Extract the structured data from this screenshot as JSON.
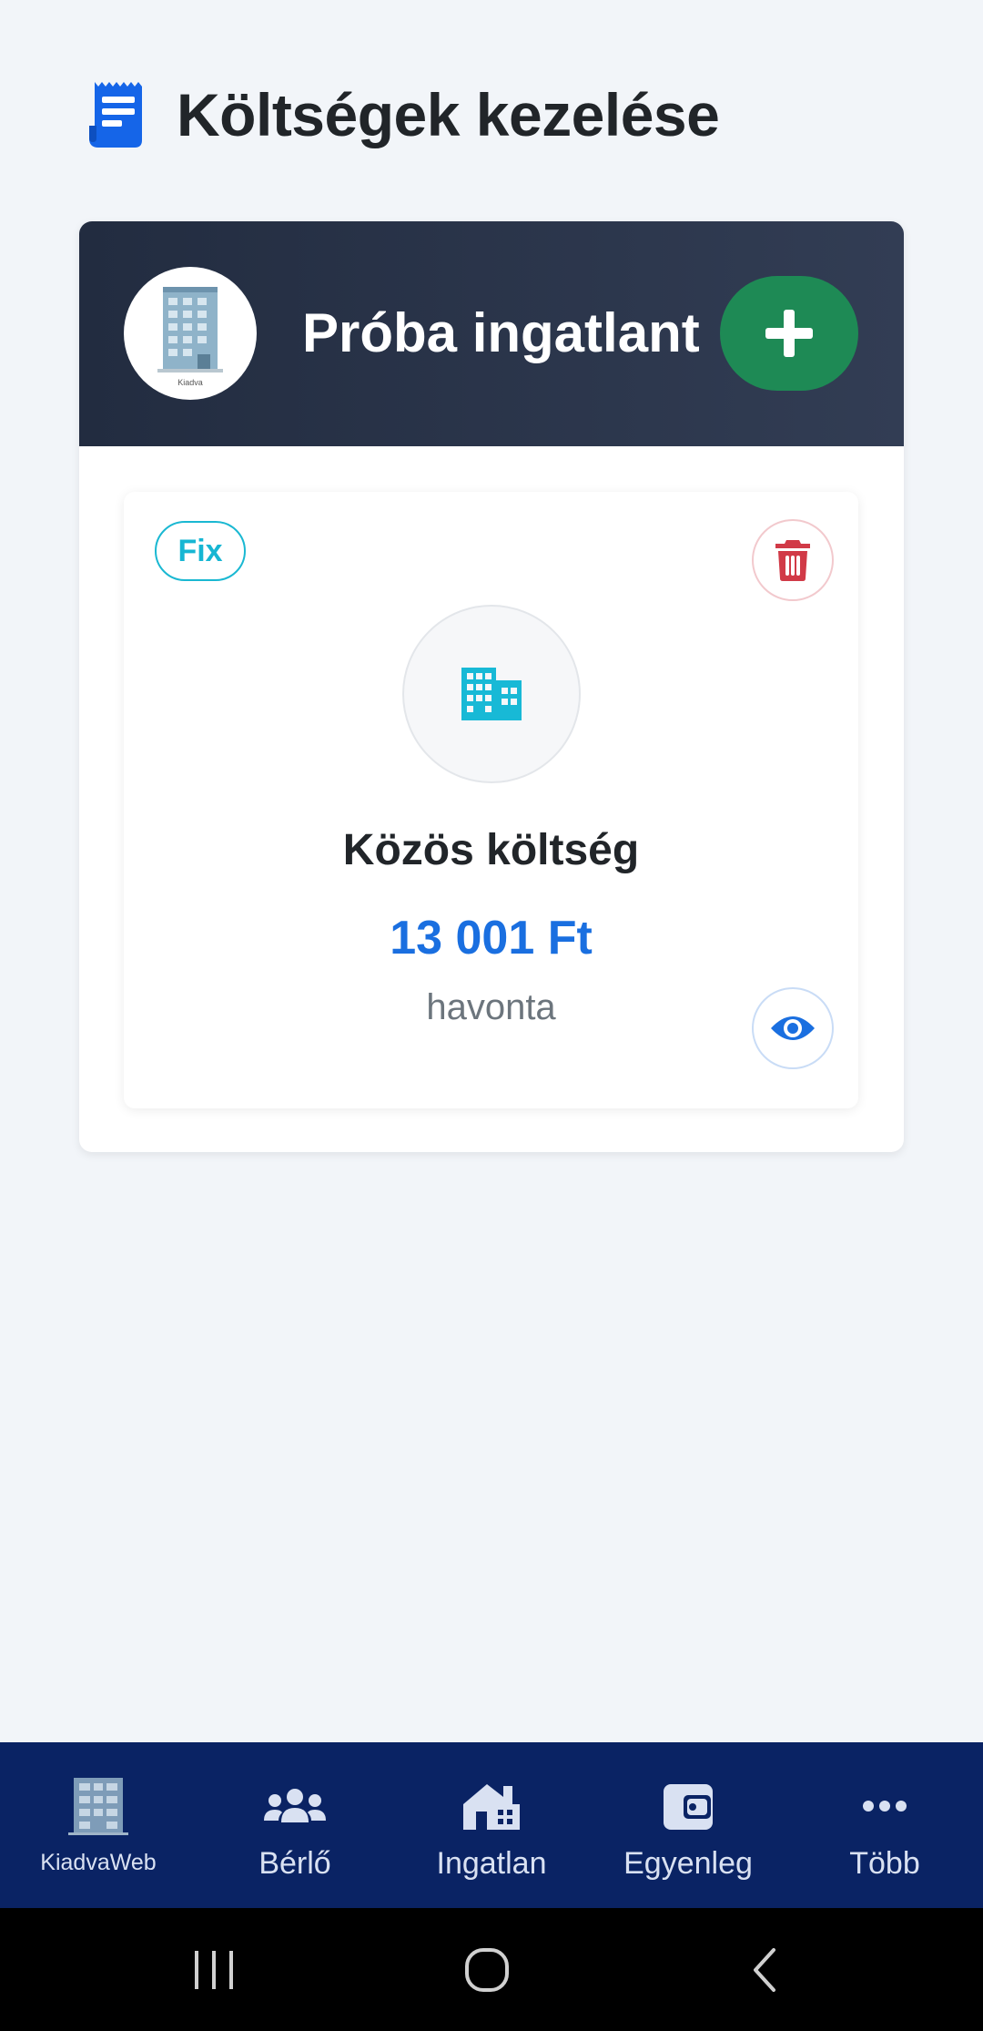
{
  "header": {
    "title": "Költségek kezelése",
    "icon": "receipt-icon"
  },
  "property": {
    "name": "Próba ingatlant",
    "avatar_caption": "Kiadva",
    "add_icon": "plus-icon"
  },
  "expense": {
    "badge": "Fix",
    "name": "Közös költség",
    "amount": "13 001 Ft",
    "frequency": "havonta",
    "category_icon": "building-icon",
    "delete_icon": "trash-icon",
    "view_icon": "eye-icon"
  },
  "bottom_nav": {
    "items": [
      {
        "label": "KiadvaWeb",
        "icon": "app-logo-icon"
      },
      {
        "label": "Bérlő",
        "icon": "users-icon"
      },
      {
        "label": "Ingatlan",
        "icon": "house-icon"
      },
      {
        "label": "Egyenleg",
        "icon": "wallet-icon"
      },
      {
        "label": "Több",
        "icon": "more-icon"
      }
    ]
  },
  "colors": {
    "accent_blue": "#1a6fe0",
    "add_green": "#1e8a55",
    "nav_bg": "#0a2364",
    "badge_cyan": "#16b6d3",
    "delete_red": "#d13a47"
  }
}
